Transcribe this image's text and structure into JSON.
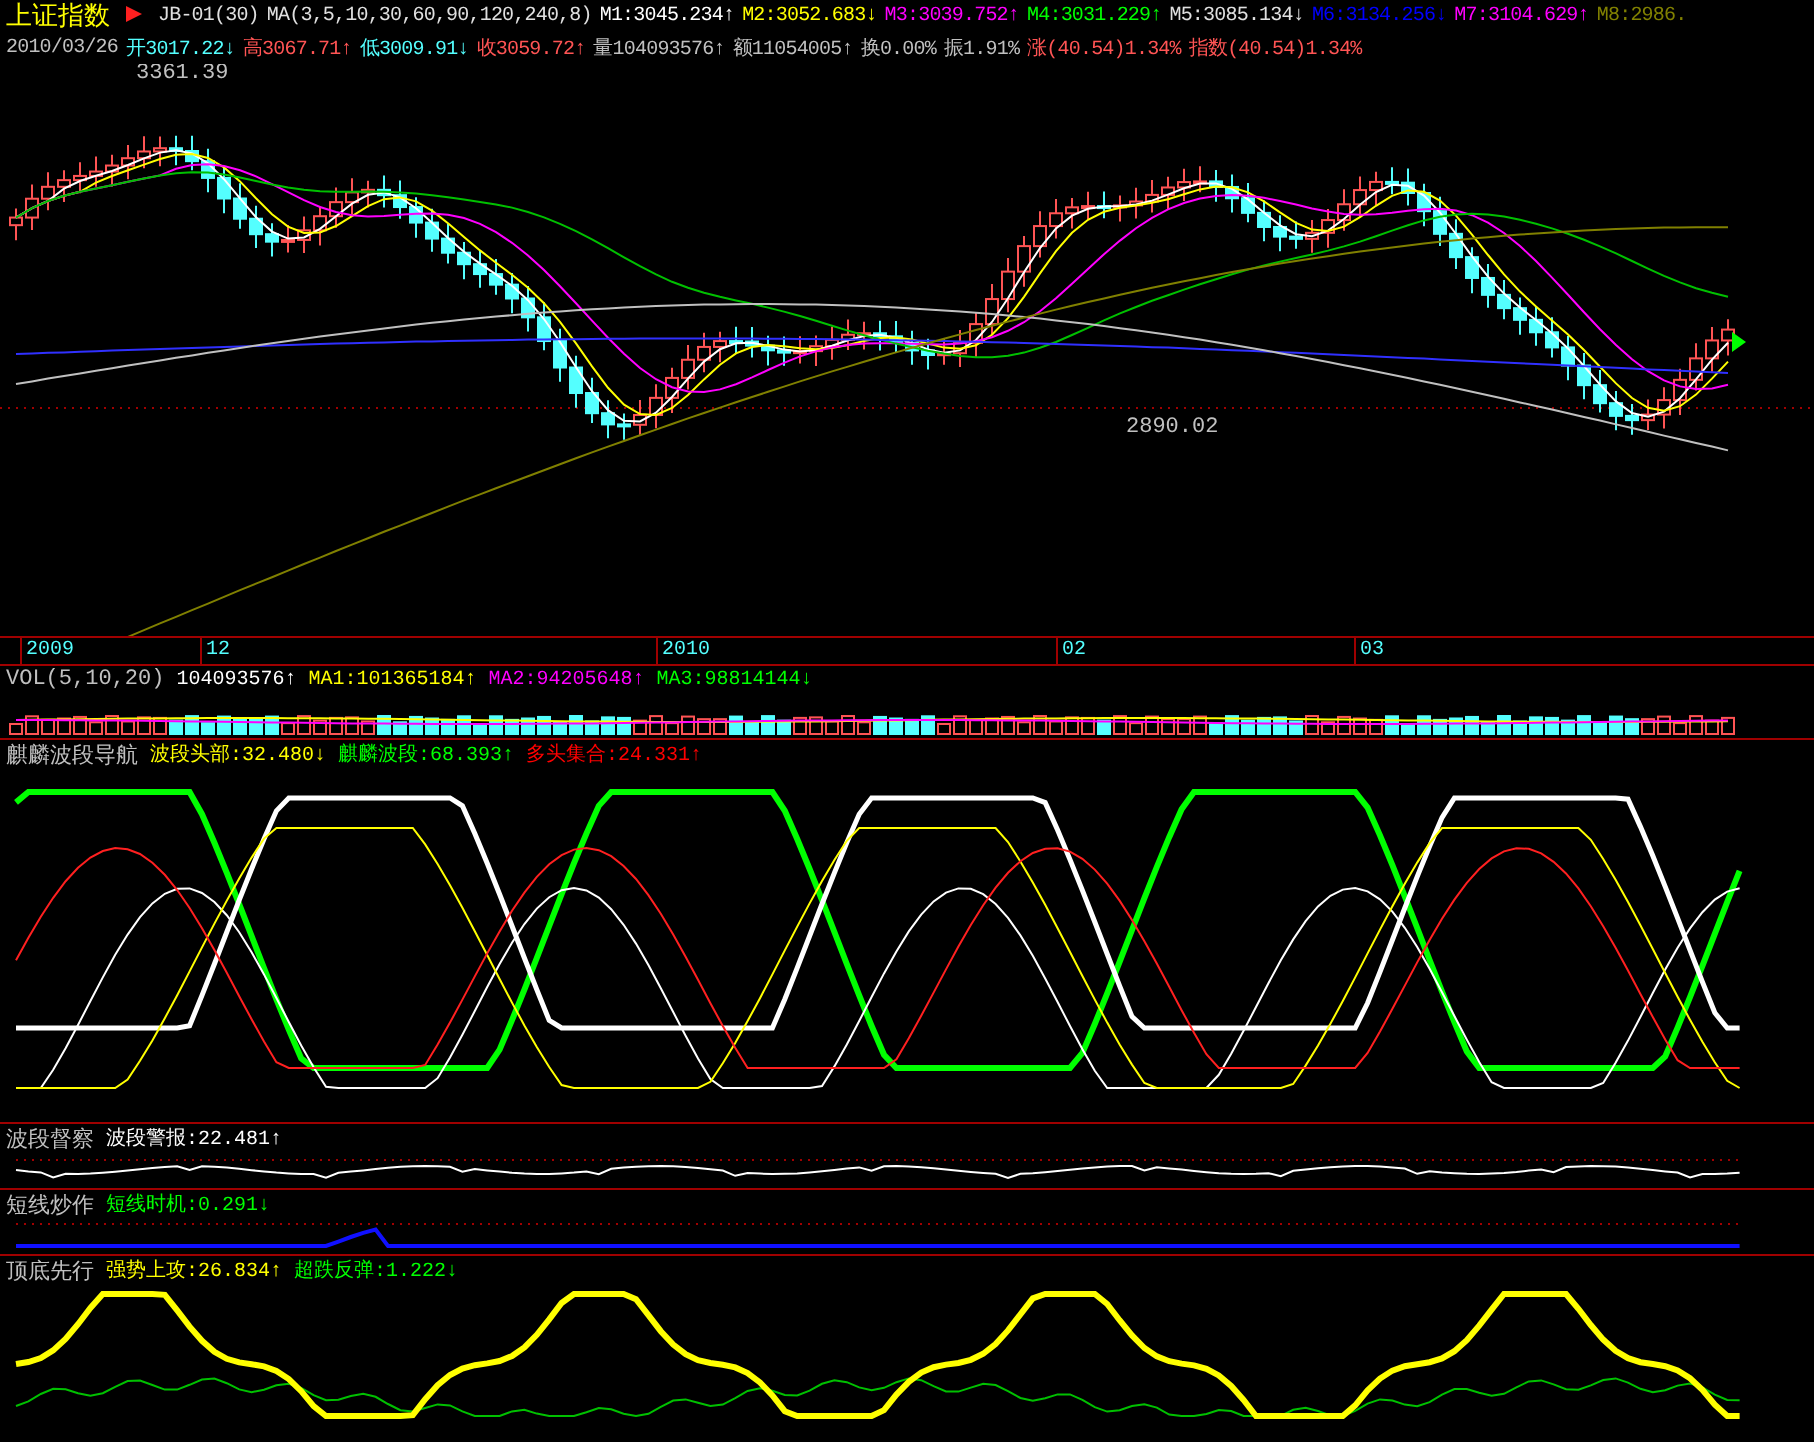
{
  "header": {
    "symbol": "上证指数",
    "line1": [
      {
        "text": "JB-01(30)",
        "color": "#e0e0e0"
      },
      {
        "text": "MA(3,5,10,30,60,90,120,240,8)",
        "color": "#e0e0e0"
      },
      {
        "text": "M1:3045.234↑",
        "color": "#ffffff"
      },
      {
        "text": "M2:3052.683↓",
        "color": "#ffff00"
      },
      {
        "text": "M3:3039.752↑",
        "color": "#ff00ff"
      },
      {
        "text": "M4:3031.229↑",
        "color": "#00ff00"
      },
      {
        "text": "M5:3085.134↓",
        "color": "#e0e0e0"
      },
      {
        "text": "M6:3134.256↓",
        "color": "#0000ff"
      },
      {
        "text": "M7:3104.629↑",
        "color": "#ff00ff"
      },
      {
        "text": "M8:2986.",
        "color": "#808000"
      }
    ],
    "line2": [
      {
        "text": "2010/03/26",
        "color": "#c0c0c0"
      },
      {
        "text": "开3017.22↓",
        "color": "#54ffff"
      },
      {
        "text": "高3067.71↑",
        "color": "#ff5454"
      },
      {
        "text": "低3009.91↓",
        "color": "#54ffff"
      },
      {
        "text": "收3059.72↑",
        "color": "#ff5454"
      },
      {
        "text": "量104093576↑",
        "color": "#c0c0c0"
      },
      {
        "text": "额11054005↑",
        "color": "#c0c0c0"
      },
      {
        "text": "换0.00%",
        "color": "#c0c0c0"
      },
      {
        "text": "振1.91%",
        "color": "#c0c0c0"
      },
      {
        "text": "涨(40.54)1.34%",
        "color": "#ff5454"
      },
      {
        "text": "指数(40.54)1.34%",
        "color": "#ff5454"
      }
    ]
  },
  "main_chart": {
    "high_label": "3361.39",
    "low_label": "2890.02"
  },
  "timeline": [
    "2009",
    "12",
    "2010",
    "02",
    "03"
  ],
  "panels": [
    {
      "title": "VOL(5,10,20)",
      "values": [
        {
          "text": "104093576↑",
          "color": "#ffffff"
        },
        {
          "text": "MA1:101365184↑",
          "color": "#ffff00"
        },
        {
          "text": "MA2:94205648↑",
          "color": "#ff00ff"
        },
        {
          "text": "MA3:98814144↓",
          "color": "#00ff00"
        }
      ]
    },
    {
      "title": "麒麟波段导航",
      "values": [
        {
          "text": "波段头部:32.480↓",
          "color": "#ffff00"
        },
        {
          "text": "麒麟波段:68.393↑",
          "color": "#00ff00"
        },
        {
          "text": "多头集合:24.331↑",
          "color": "#ff0000"
        }
      ]
    },
    {
      "title": "波段督察",
      "values": [
        {
          "text": "波段警报:22.481↑",
          "color": "#ffffff"
        }
      ]
    },
    {
      "title": "短线炒作",
      "values": [
        {
          "text": "短线时机:0.291↓",
          "color": "#00ff00"
        }
      ]
    },
    {
      "title": "顶底先行",
      "values": [
        {
          "text": "强势上攻:26.834↑",
          "color": "#ffff00"
        },
        {
          "text": "超跌反弹:1.222↓",
          "color": "#00ff00"
        }
      ]
    }
  ]
}
